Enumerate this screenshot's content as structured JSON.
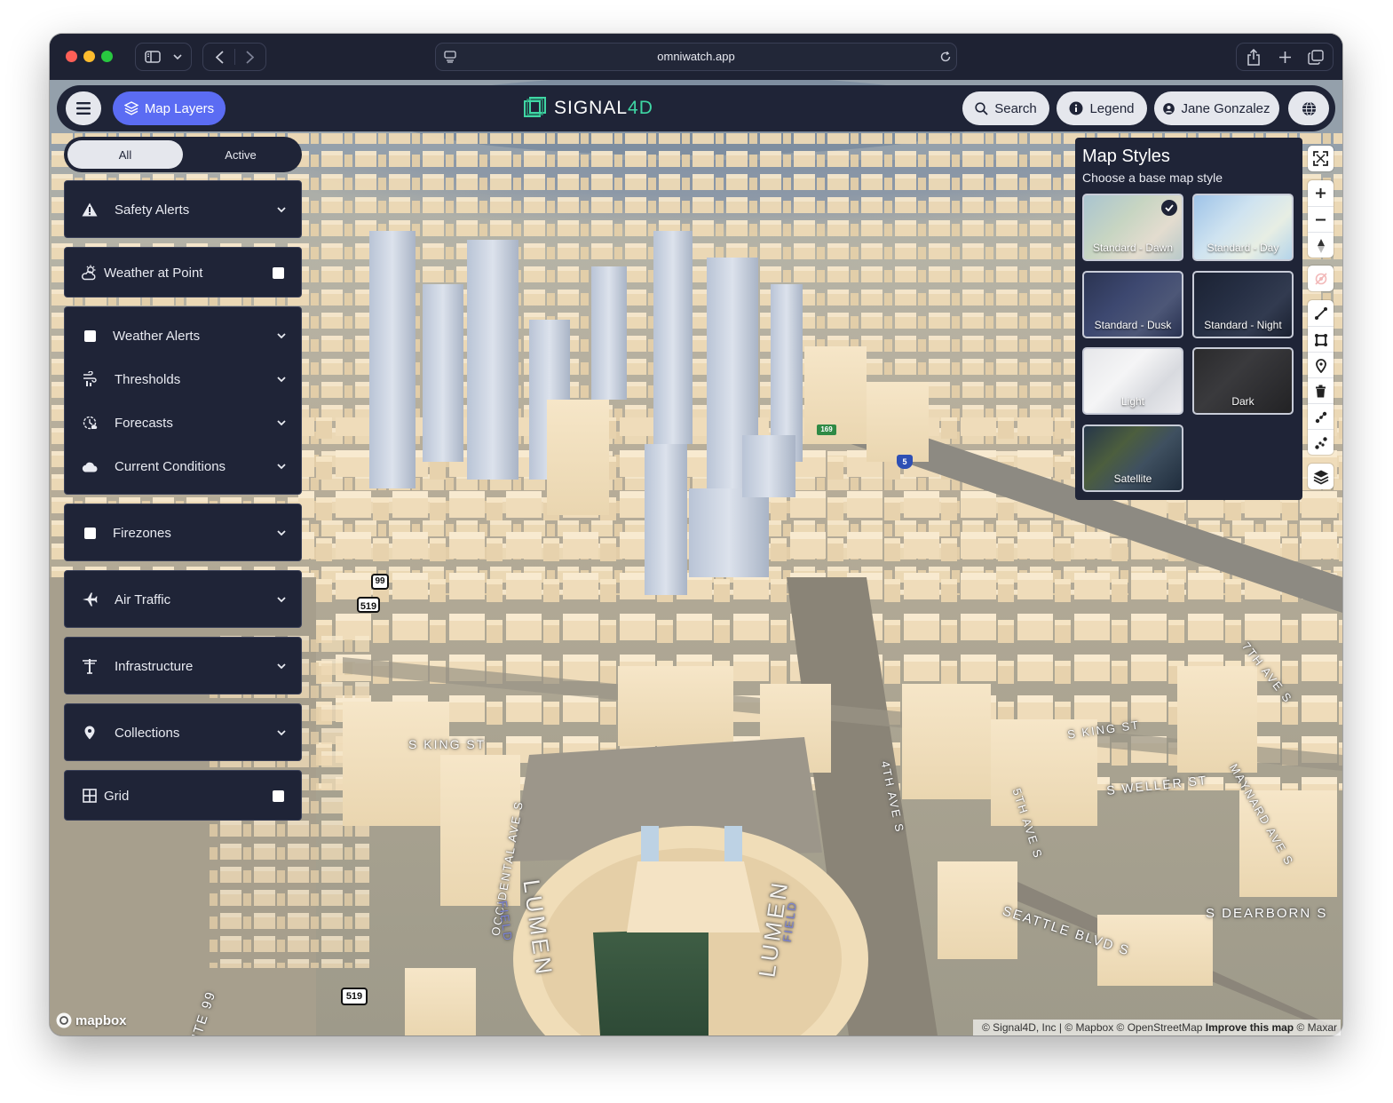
{
  "browser": {
    "url": "omniwatch.app"
  },
  "header": {
    "map_layers_label": "Map Layers",
    "logo_text_main": "SIGNAL",
    "logo_text_accent": "4D",
    "search_label": "Search",
    "legend_label": "Legend",
    "user_name": "Jane Gonzalez"
  },
  "layer_tabs": {
    "all_label": "All",
    "active_label": "Active"
  },
  "layers": {
    "safety_alerts": "Safety Alerts",
    "weather_at_point": "Weather at Point",
    "weather_alerts": "Weather Alerts",
    "thresholds": "Thresholds",
    "forecasts": "Forecasts",
    "current_conditions": "Current Conditions",
    "firezones": "Firezones",
    "air_traffic": "Air Traffic",
    "infrastructure": "Infrastructure",
    "collections": "Collections",
    "grid": "Grid"
  },
  "map_styles": {
    "title": "Map Styles",
    "subtitle": "Choose a base map style",
    "options": [
      {
        "label": "Standard - Dawn",
        "selected": true
      },
      {
        "label": "Standard - Day",
        "selected": false
      },
      {
        "label": "Standard - Dusk",
        "selected": false
      },
      {
        "label": "Standard - Night",
        "selected": false
      },
      {
        "label": "Light",
        "selected": false
      },
      {
        "label": "Dark",
        "selected": false
      },
      {
        "label": "Satellite",
        "selected": false
      }
    ]
  },
  "map_labels": {
    "king_st_left": "S KING ST",
    "king_st_right": "S KING ST",
    "weller_st": "S WELLER ST",
    "dearborn_st": "S DEARBORN S",
    "seattle_blvd": "SEATTLE BLVD S",
    "fourth_ave": "4TH AVE S",
    "fifth_ave": "5TH AVE S",
    "maynard_ave": "MAYNARD AVE S",
    "seventh_ave": "7TH AVE S",
    "occidental_ave": "OCCIDENTAL AVE S",
    "route_99": "ROUTE 99",
    "stadium_left": "LUMEN",
    "stadium_left_sub": "FIELD",
    "stadium_right": "LUMEN",
    "stadium_right_sub": "FIELD",
    "shield_519_a": "519",
    "shield_519_b": "519",
    "shield_99": "99",
    "shield_5": "5",
    "shield_169": "169"
  },
  "map_attribution": {
    "mapbox_logo": "mapbox",
    "prefix": "© Signal4D, Inc | © Mapbox © OpenStreetMap",
    "improve": "Improve this map",
    "suffix": "© Maxar"
  },
  "icons": {
    "menu": "hamburger-icon",
    "layers": "layers-icon",
    "search": "search-icon",
    "legend": "info-icon",
    "user": "user-icon",
    "globe": "globe-icon"
  },
  "colors": {
    "header_bg": "#1f2437",
    "accent": "#5b6cf3",
    "logo_accent": "#3fd7a4",
    "building": "#f0dcb8"
  }
}
